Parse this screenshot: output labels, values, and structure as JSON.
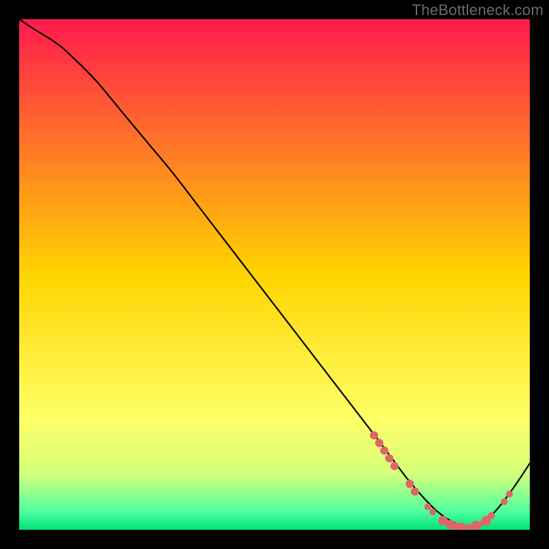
{
  "watermark": "TheBottleneck.com",
  "chart_data": {
    "type": "line",
    "title": "",
    "xlabel": "",
    "ylabel": "",
    "xlim": [
      0,
      100
    ],
    "ylim": [
      0,
      100
    ],
    "background_gradient": {
      "stops": [
        {
          "offset": 0.0,
          "color": "#ff1a4d"
        },
        {
          "offset": 0.5,
          "color": "#ffd400"
        },
        {
          "offset": 0.78,
          "color": "#ffff66"
        },
        {
          "offset": 0.89,
          "color": "#d4ff7a"
        },
        {
          "offset": 0.965,
          "color": "#4dff9e"
        },
        {
          "offset": 1.0,
          "color": "#00e07a"
        }
      ]
    },
    "series": [
      {
        "name": "bottleneck-curve",
        "color": "#000000",
        "width": 2.2,
        "x": [
          0,
          3,
          7,
          10,
          15,
          20,
          25,
          30,
          35,
          40,
          45,
          50,
          55,
          60,
          65,
          70,
          73,
          76,
          79,
          82,
          85,
          88,
          91,
          94,
          97,
          100
        ],
        "y": [
          100,
          98,
          95.5,
          93,
          88,
          82,
          76,
          70,
          63.5,
          57,
          50.5,
          44,
          37.5,
          31,
          24.5,
          18,
          14,
          10,
          6.5,
          3.5,
          1.5,
          0.5,
          1.5,
          4.5,
          8.5,
          13
        ]
      }
    ],
    "markers": {
      "name": "bottleneck-dots",
      "color": "#e06666",
      "radius_range": [
        4,
        9
      ],
      "points": [
        {
          "x": 69.5,
          "y": 18.5,
          "r": 6
        },
        {
          "x": 70.5,
          "y": 17.0,
          "r": 6
        },
        {
          "x": 71.5,
          "y": 15.5,
          "r": 6
        },
        {
          "x": 72.5,
          "y": 14.0,
          "r": 6
        },
        {
          "x": 73.5,
          "y": 12.5,
          "r": 6
        },
        {
          "x": 76.5,
          "y": 9.0,
          "r": 6
        },
        {
          "x": 77.5,
          "y": 7.5,
          "r": 6
        },
        {
          "x": 80.0,
          "y": 4.5,
          "r": 5
        },
        {
          "x": 81.0,
          "y": 3.5,
          "r": 5
        },
        {
          "x": 83.0,
          "y": 1.8,
          "r": 7
        },
        {
          "x": 84.5,
          "y": 1.0,
          "r": 7
        },
        {
          "x": 85.5,
          "y": 0.7,
          "r": 5
        },
        {
          "x": 86.5,
          "y": 0.5,
          "r": 7
        },
        {
          "x": 88.0,
          "y": 0.5,
          "r": 5
        },
        {
          "x": 89.5,
          "y": 0.8,
          "r": 7
        },
        {
          "x": 90.5,
          "y": 1.2,
          "r": 4
        },
        {
          "x": 91.5,
          "y": 1.8,
          "r": 7
        },
        {
          "x": 92.5,
          "y": 2.8,
          "r": 5
        },
        {
          "x": 95.0,
          "y": 5.5,
          "r": 5
        },
        {
          "x": 96.0,
          "y": 7.0,
          "r": 5
        }
      ]
    }
  }
}
